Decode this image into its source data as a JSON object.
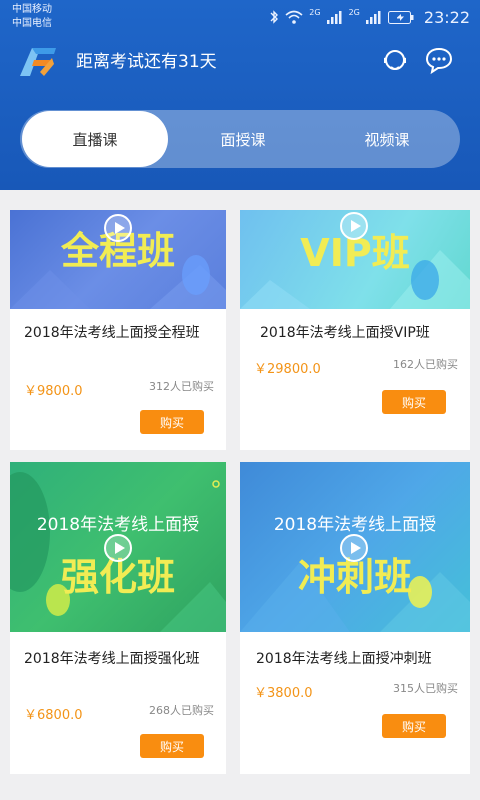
{
  "status_bar": {
    "carrier1": "中国移动",
    "carrier2": "中国电信",
    "signal1_label": "2G",
    "signal2_label": "2G",
    "time": "23:22"
  },
  "header": {
    "exam_countdown": "距离考试还有31天"
  },
  "tabs": [
    {
      "label": "直播课"
    },
    {
      "label": "面授课"
    },
    {
      "label": "视频课"
    }
  ],
  "courses": [
    {
      "thumb_text": "全程班",
      "title": "2018年法考线上面授全程班",
      "price": "￥9800.0",
      "buyers": "312人已购买",
      "buy_label": "购买"
    },
    {
      "thumb_text": "VIP班",
      "title": "2018年法考线上面授VIP班",
      "price": "￥29800.0",
      "buyers": "162人已购买",
      "buy_label": "购买"
    },
    {
      "thumb_caption": "2018年法考线上面授",
      "thumb_text": "强化班",
      "title": "2018年法考线上面授强化班",
      "price": "￥6800.0",
      "buyers": "268人已购买",
      "buy_label": "购买"
    },
    {
      "thumb_caption": "2018年法考线上面授",
      "thumb_text": "冲刺班",
      "title": "2018年法考线上面授冲刺班",
      "price": "￥3800.0",
      "buyers": "315人已购买",
      "buy_label": "购买"
    }
  ],
  "colors": {
    "header_blue": "#1f66c9",
    "price_orange": "#f39418",
    "button_orange": "#f98d10",
    "thumb_text_yellow": "#f1ec54"
  },
  "icons": [
    "bluetooth-icon",
    "wifi-icon",
    "signal-icon",
    "battery-icon",
    "support-headset-icon",
    "chat-bubble-icon",
    "play-icon"
  ]
}
